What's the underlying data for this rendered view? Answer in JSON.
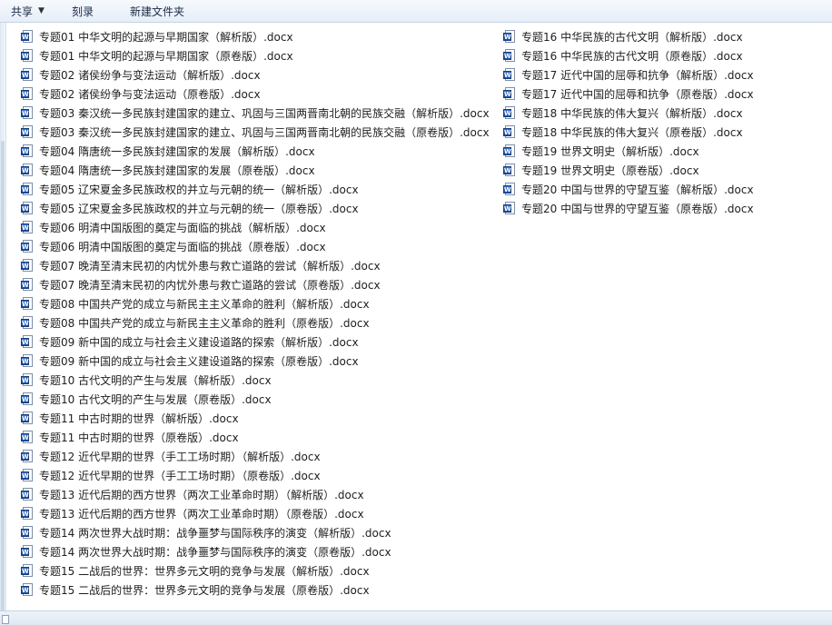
{
  "toolbar": {
    "share_label": "共享",
    "share_caret": "▼",
    "burn_label": "刻录",
    "new_folder_label": "新建文件夹"
  },
  "file_icon": "word-document-icon",
  "file_icon_glyph": "W",
  "files_left": [
    "专题01  中华文明的起源与早期国家（解析版）.docx",
    "专题01  中华文明的起源与早期国家（原卷版）.docx",
    "专题02  诸侯纷争与变法运动（解析版）.docx",
    "专题02  诸侯纷争与变法运动（原卷版）.docx",
    "专题03 秦汉统一多民族封建国家的建立、巩固与三国两晋南北朝的民族交融（解析版）.docx",
    "专题03 秦汉统一多民族封建国家的建立、巩固与三国两晋南北朝的民族交融（原卷版）.docx",
    "专题04  隋唐统一多民族封建国家的发展（解析版）.docx",
    "专题04  隋唐统一多民族封建国家的发展（原卷版）.docx",
    "专题05  辽宋夏金多民族政权的并立与元朝的统一（解析版）.docx",
    "专题05  辽宋夏金多民族政权的并立与元朝的统一（原卷版）.docx",
    "专题06 明清中国版图的奠定与面临的挑战（解析版）.docx",
    "专题06 明清中国版图的奠定与面临的挑战（原卷版）.docx",
    "专题07  晚清至清末民初的内忧外患与救亡道路的尝试（解析版）.docx",
    "专题07  晚清至清末民初的内忧外患与救亡道路的尝试（原卷版）.docx",
    "专题08  中国共产党的成立与新民主主义革命的胜利（解析版）.docx",
    "专题08  中国共产党的成立与新民主主义革命的胜利（原卷版）.docx",
    "专题09  新中国的成立与社会主义建设道路的探索（解析版）.docx",
    "专题09  新中国的成立与社会主义建设道路的探索（原卷版）.docx",
    "专题10  古代文明的产生与发展（解析版）.docx",
    "专题10  古代文明的产生与发展（原卷版）.docx",
    "专题11  中古时期的世界（解析版）.docx",
    "专题11  中古时期的世界（原卷版）.docx",
    "专题12  近代早期的世界（手工工场时期）（解析版）.docx",
    "专题12  近代早期的世界（手工工场时期）（原卷版）.docx",
    "专题13  近代后期的西方世界（两次工业革命时期）（解析版）.docx",
    "专题13  近代后期的西方世界（两次工业革命时期）（原卷版）.docx",
    "专题14  两次世界大战时期：战争噩梦与国际秩序的演变（解析版）.docx",
    "专题14  两次世界大战时期：战争噩梦与国际秩序的演变（原卷版）.docx",
    "专题15  二战后的世界：世界多元文明的竞争与发展（解析版）.docx",
    "专题15  二战后的世界：世界多元文明的竞争与发展（原卷版）.docx"
  ],
  "files_right": [
    "专题16  中华民族的古代文明（解析版）.docx",
    "专题16  中华民族的古代文明（原卷版）.docx",
    "专题17  近代中国的屈辱和抗争（解析版）.docx",
    "专题17  近代中国的屈辱和抗争（原卷版）.docx",
    "专题18  中华民族的伟大复兴（解析版）.docx",
    "专题18  中华民族的伟大复兴（原卷版）.docx",
    "专题19  世界文明史（解析版）.docx",
    "专题19  世界文明史（原卷版）.docx",
    "专题20  中国与世界的守望互鉴（解析版）.docx",
    "专题20  中国与世界的守望互鉴（原卷版）.docx"
  ]
}
